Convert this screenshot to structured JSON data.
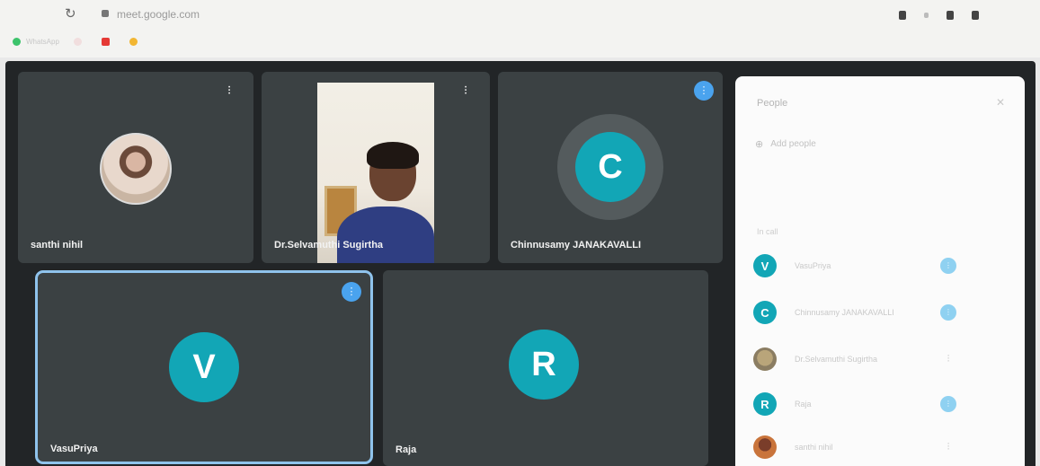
{
  "browser": {
    "url": "meet.google.com",
    "bookmarks": [
      {
        "label": "WhatsApp",
        "color": "#3cc36b"
      },
      {
        "label": "",
        "color": "#f2f2f2"
      },
      {
        "label": "",
        "color": "#e53935"
      },
      {
        "label": "",
        "color": "#f2b632"
      }
    ]
  },
  "tiles": [
    {
      "name": "santhi nihil",
      "kind": "photo",
      "indicator": "mute"
    },
    {
      "name": "Dr.Selvamuthi Sugirtha",
      "kind": "video",
      "indicator": "mute"
    },
    {
      "name": "Chinnusamy JANAKAVALLI",
      "kind": "letter",
      "letter": "C",
      "indicator": "speaking"
    },
    {
      "name": "VasuPriya",
      "kind": "letter",
      "letter": "V",
      "indicator": "speaking"
    },
    {
      "name": "Raja",
      "kind": "letter",
      "letter": "R",
      "indicator": "none"
    }
  ],
  "panel": {
    "title": "People",
    "add_label": "Add people",
    "section_label": "In call",
    "participants": [
      {
        "initial": "V",
        "name": "VasuPriya",
        "status": "speaking",
        "avatar": "letter"
      },
      {
        "initial": "C",
        "name": "Chinnusamy JANAKAVALLI",
        "status": "speaking",
        "avatar": "letter"
      },
      {
        "initial": "",
        "name": "Dr.Selvamuthi Sugirtha",
        "status": "mic",
        "avatar": "photo"
      },
      {
        "initial": "R",
        "name": "Raja",
        "status": "speaking",
        "avatar": "letter"
      },
      {
        "initial": "",
        "name": "santhi nihil",
        "status": "mic",
        "avatar": "photo2"
      }
    ]
  },
  "colors": {
    "accent": "#12a6b6",
    "active_outline": "#8fc3ec",
    "speaking": "#4aa3ee"
  }
}
